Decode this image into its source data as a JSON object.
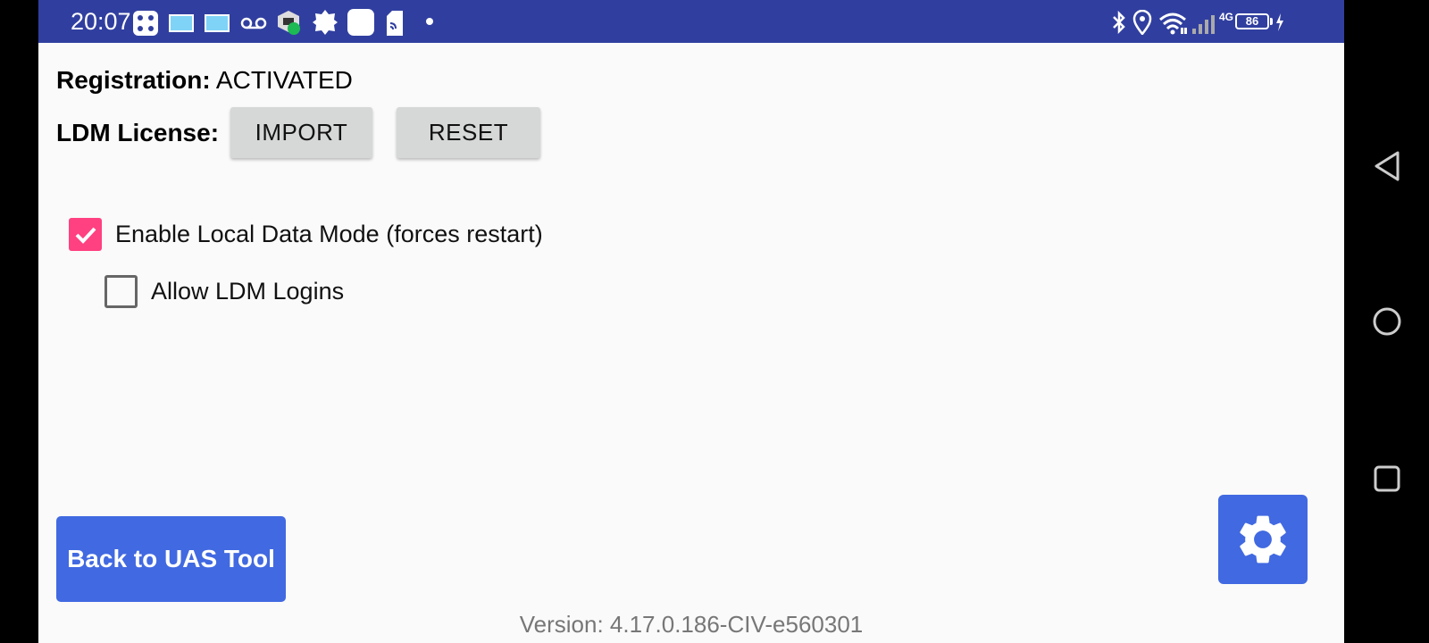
{
  "status_bar": {
    "time": "20:07",
    "battery_level": "86",
    "network_type": "4G",
    "icons": [
      "notification-grid-icon",
      "message-icon",
      "message-icon",
      "voicemail-icon",
      "app-icon",
      "settings-gear-icon",
      "app-square-icon",
      "sim-card-icon",
      "dot-icon",
      "bluetooth-icon",
      "location-icon",
      "wifi-icon",
      "signal-icon",
      "battery-icon",
      "charging-icon"
    ],
    "background_color": "#303f9f"
  },
  "registration": {
    "label": "Registration:",
    "value": "ACTIVATED"
  },
  "ldm_license": {
    "label": "LDM License:",
    "import_label": "IMPORT",
    "reset_label": "RESET"
  },
  "options": {
    "enable_ldm": {
      "label": "Enable Local Data Mode (forces restart)",
      "checked": true
    },
    "allow_ldm_logins": {
      "label": "Allow LDM Logins",
      "checked": false
    }
  },
  "back_button": {
    "label": "Back to UAS Tool"
  },
  "version": {
    "text": "Version: 4.17.0.186-CIV-e560301"
  },
  "colors": {
    "accent": "#4169e1",
    "checkbox_checked": "#ff4081",
    "button_gray": "#d6d7d7"
  },
  "nav_bar": {
    "icons": [
      "back-triangle-icon",
      "home-circle-icon",
      "recents-square-icon"
    ]
  }
}
